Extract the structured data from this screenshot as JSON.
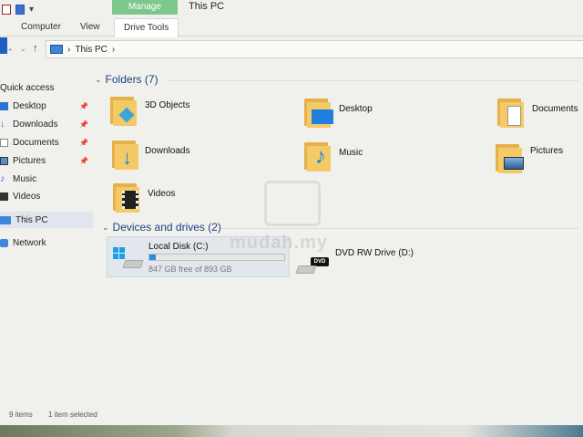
{
  "window": {
    "title": "This PC"
  },
  "ribbon": {
    "context_tab": "Manage",
    "tabs": [
      "Computer",
      "View"
    ],
    "active_tab": "Drive Tools"
  },
  "address_bar": {
    "separator": "›",
    "path": [
      "This PC"
    ],
    "dropdown": "⌄"
  },
  "sidebar": {
    "quick_access": "Quick access",
    "pinned": [
      {
        "label": "Desktop",
        "icon": "desktop-icon",
        "pinned": true
      },
      {
        "label": "Downloads",
        "icon": "downloads-icon",
        "pinned": true
      },
      {
        "label": "Documents",
        "icon": "documents-icon",
        "pinned": true
      },
      {
        "label": "Pictures",
        "icon": "pictures-icon",
        "pinned": true
      },
      {
        "label": "Music",
        "icon": "music-icon",
        "pinned": false
      },
      {
        "label": "Videos",
        "icon": "videos-icon",
        "pinned": false
      }
    ],
    "this_pc": "This PC",
    "network": "Network"
  },
  "folders_section": {
    "title": "Folders (7)",
    "items": [
      {
        "label": "3D Objects",
        "icon": "3d-objects-folder-icon"
      },
      {
        "label": "Desktop",
        "icon": "desktop-folder-icon"
      },
      {
        "label": "Documents",
        "icon": "documents-folder-icon"
      },
      {
        "label": "Downloads",
        "icon": "downloads-folder-icon"
      },
      {
        "label": "Music",
        "icon": "music-folder-icon"
      },
      {
        "label": "Pictures",
        "icon": "pictures-folder-icon"
      },
      {
        "label": "Videos",
        "icon": "videos-folder-icon"
      }
    ]
  },
  "drives_section": {
    "title": "Devices and drives (2)",
    "local_disk": {
      "name": "Local Disk (C:)",
      "free_text": "847 GB free of 893 GB",
      "used_fraction": 0.05
    },
    "dvd": {
      "name": "DVD RW Drive (D:)",
      "badge": "DVD"
    }
  },
  "status_bar": {
    "item_count": "9 items",
    "selection": "1 item selected"
  },
  "watermark": "mudah.my",
  "colors": {
    "accent_blue": "#1e3f86",
    "manage_tab": "#7ec78a",
    "folder_yellow": "#f4ca66",
    "selection": "#e2e7ed"
  }
}
